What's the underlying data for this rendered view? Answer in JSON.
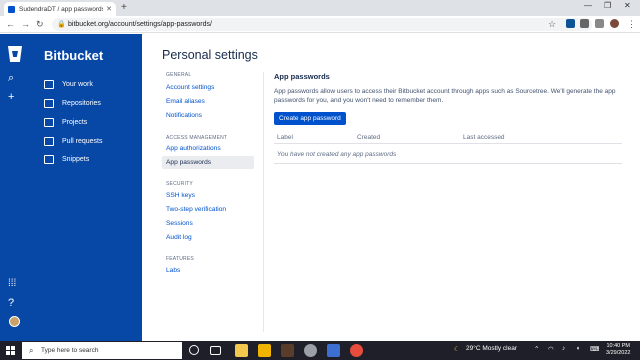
{
  "browser": {
    "tab_title": "SudendraDT / app passwords —",
    "url": "bitbucket.org/account/settings/app-passwords/"
  },
  "sidebar": {
    "brand": "Bitbucket",
    "items": [
      {
        "label": "Your work"
      },
      {
        "label": "Repositories"
      },
      {
        "label": "Projects"
      },
      {
        "label": "Pull requests"
      },
      {
        "label": "Snippets"
      }
    ]
  },
  "page": {
    "title": "Personal settings"
  },
  "settings_nav": {
    "general_heading": "GENERAL",
    "general": [
      "Account settings",
      "Email aliases",
      "Notifications"
    ],
    "access_heading": "ACCESS MANAGEMENT",
    "access": [
      "App authorizations",
      "App passwords"
    ],
    "security_heading": "SECURITY",
    "security": [
      "SSH keys",
      "Two-step verification",
      "Sessions",
      "Audit log"
    ],
    "features_heading": "FEATURES",
    "features": [
      "Labs"
    ]
  },
  "content": {
    "title": "App passwords",
    "description": "App passwords allow users to access their Bitbucket account through apps such as Sourcetree. We'll generate the app passwords for you, and you won't need to remember them.",
    "create_button": "Create app password",
    "columns": [
      "Label",
      "Created",
      "Last accessed"
    ],
    "empty_message": "You have not created any app passwords"
  },
  "taskbar": {
    "search_placeholder": "Type here to search",
    "weather": "29°C  Mostly clear",
    "time": "10:40 PM",
    "date": "3/29/2022"
  },
  "colors": {
    "sidebar": "#0747a6",
    "primary": "#0052cc",
    "text": "#172b4d"
  }
}
